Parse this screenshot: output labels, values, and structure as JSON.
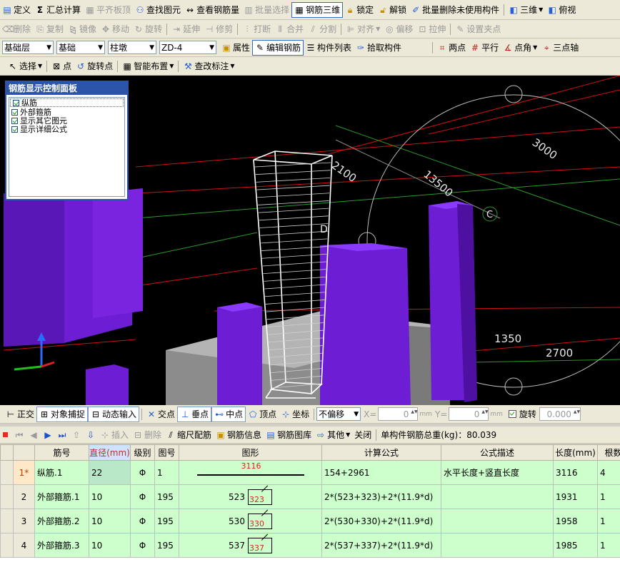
{
  "toolbar1": {
    "items": [
      {
        "label": "定义",
        "icon": "define-icon",
        "disabled": false
      },
      {
        "label": "汇总计算",
        "icon": "sigma-icon",
        "disabled": false
      },
      {
        "label": "平齐板顶",
        "icon": "align-top-icon",
        "disabled": true
      },
      {
        "label": "查找图元",
        "icon": "binoculars-icon",
        "disabled": false
      },
      {
        "label": "查看钢筋量",
        "icon": "view-rebar-icon",
        "disabled": false
      },
      {
        "label": "批量选择",
        "icon": "batch-select-icon",
        "disabled": true
      },
      {
        "label": "钢筋三维",
        "icon": "rebar-3d-icon",
        "disabled": false,
        "active": true
      },
      {
        "label": "锁定",
        "icon": "lock-icon",
        "disabled": false
      },
      {
        "label": "解锁",
        "icon": "unlock-icon",
        "disabled": false
      },
      {
        "label": "批量删除未使用构件",
        "icon": "batch-delete-icon",
        "disabled": false
      },
      {
        "label": "三维",
        "icon": "cube-icon",
        "disabled": false
      },
      {
        "label": "俯视",
        "icon": "top-view-icon",
        "disabled": false
      }
    ]
  },
  "toolbar2": {
    "items": [
      {
        "label": "删除",
        "icon": "eraser-icon"
      },
      {
        "label": "复制",
        "icon": "copy-icon"
      },
      {
        "label": "镜像",
        "icon": "mirror-icon"
      },
      {
        "label": "移动",
        "icon": "move-icon"
      },
      {
        "label": "旋转",
        "icon": "rotate-icon"
      },
      {
        "label": "延伸",
        "icon": "extend-icon"
      },
      {
        "label": "修剪",
        "icon": "trim-icon"
      },
      {
        "label": "打断",
        "icon": "break-icon"
      },
      {
        "label": "合并",
        "icon": "merge-icon"
      },
      {
        "label": "分割",
        "icon": "split-icon"
      },
      {
        "label": "对齐",
        "icon": "align-icon"
      },
      {
        "label": "偏移",
        "icon": "offset-icon"
      },
      {
        "label": "拉伸",
        "icon": "stretch-icon"
      },
      {
        "label": "设置夹点",
        "icon": "grip-icon"
      }
    ]
  },
  "toolbar3": {
    "floor": "基础层",
    "category": "基础",
    "component_type": "柱墩",
    "component": "ZD-4",
    "properties": "属性",
    "edit_rebar": "编辑钢筋",
    "component_list": "构件列表",
    "pick_component": "拾取构件",
    "two_points": "两点",
    "parallel": "平行",
    "point_angle": "点角",
    "three_points": "三点轴"
  },
  "toolbar4": {
    "select": "选择",
    "point": "点",
    "rotate_point": "旋转点",
    "smart_layout": "智能布置",
    "modify_label": "查改标注"
  },
  "panel": {
    "title": "钢筋显示控制面板",
    "options": [
      "纵筋",
      "外部箍筋",
      "显示其它图元",
      "显示详细公式"
    ]
  },
  "viewport_labels": {
    "dim1": "2100",
    "dim2": "13500",
    "dim3": "3000",
    "dim4": "1350",
    "dim5": "2700",
    "axis_c": "C",
    "axis_d": "D"
  },
  "snapbar": {
    "ortho": "正交",
    "object_snap": "对象捕捉",
    "dynamic_input": "动态输入",
    "intersection": "交点",
    "perpendicular": "垂点",
    "midpoint": "中点",
    "vertex": "顶点",
    "coordinate": "坐标",
    "offset_mode": "不偏移",
    "x_label": "X=",
    "x_value": "0",
    "y_label": "Y=",
    "y_value": "0",
    "unit": "mm",
    "rotate": "旋转",
    "rotate_value": "0.000"
  },
  "gridtoolbar": {
    "insert": "插入",
    "delete": "删除",
    "scale_rebar": "缩尺配筋",
    "rebar_info": "钢筋信息",
    "rebar_library": "钢筋图库",
    "other": "其他",
    "close": "关闭",
    "total_weight": "单构件钢筋总重(kg)：80.039"
  },
  "table": {
    "headers": [
      "",
      "筋号",
      "直径(mm)",
      "级别",
      "图号",
      "图形",
      "计算公式",
      "公式描述",
      "长度(mm)",
      "根数"
    ],
    "rows": [
      {
        "no": "1*",
        "name": "纵筋.1",
        "dia": "22",
        "grade": "Φ",
        "fig": "1",
        "shape_type": "line",
        "shape_a": "3116",
        "shape_b": "",
        "formula": "154+2961",
        "desc": "水平长度+竖直长度",
        "length": "3116",
        "count": "4"
      },
      {
        "no": "2",
        "name": "外部箍筋.1",
        "dia": "10",
        "grade": "Φ",
        "fig": "195",
        "shape_type": "stirrup",
        "shape_a": "523",
        "shape_b": "323",
        "formula": "2*(523+323)+2*(11.9*d)",
        "desc": "",
        "length": "1931",
        "count": "1"
      },
      {
        "no": "3",
        "name": "外部箍筋.2",
        "dia": "10",
        "grade": "Φ",
        "fig": "195",
        "shape_type": "stirrup",
        "shape_a": "530",
        "shape_b": "330",
        "formula": "2*(530+330)+2*(11.9*d)",
        "desc": "",
        "length": "1958",
        "count": "1"
      },
      {
        "no": "4",
        "name": "外部箍筋.3",
        "dia": "10",
        "grade": "Φ",
        "fig": "195",
        "shape_type": "stirrup",
        "shape_a": "537",
        "shape_b": "337",
        "formula": "2*(537+337)+2*(11.9*d)",
        "desc": "",
        "length": "1985",
        "count": "1"
      }
    ]
  }
}
